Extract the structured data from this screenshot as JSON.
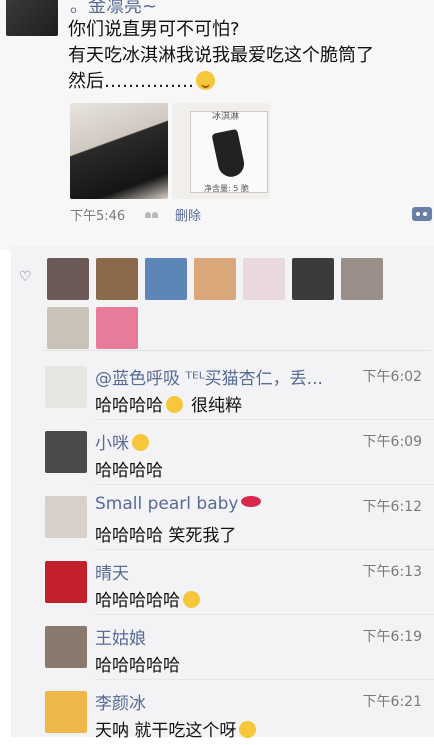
{
  "post": {
    "author": "。金凛亮~",
    "lines": [
      "你们说直男可不可怕?",
      "有天吃冰淇淋我说我最爱吃这个脆筒了",
      "然后……………"
    ],
    "photo2_caption_top": "冰淇淋",
    "photo2_caption_bottom": "净含量: 5 脆",
    "time": "下午5:46",
    "delete_label": "删除"
  },
  "likes": {
    "icon": "heart-outline-icon",
    "avatars": [
      {
        "color": "#6b5a58"
      },
      {
        "color": "#8a6a4a"
      },
      {
        "color": "#5d86b8"
      },
      {
        "color": "#d9a77a"
      },
      {
        "color": "#e9d8e0"
      },
      {
        "color": "#3b3b3b"
      },
      {
        "color": "#9a8f88"
      },
      {
        "color": "#c9c2b8"
      },
      {
        "color": "#e77c9a"
      }
    ]
  },
  "comments": [
    {
      "name": "@蓝色呼吸 ᵀᴱᴸ买猫杏仁，丢...",
      "time": "下午6:02",
      "text": "哈哈哈哈",
      "suffix": "很纯粹",
      "emoji": "grin-emoji",
      "avatar": "#e8e6e3"
    },
    {
      "name": "小咪",
      "time": "下午6:09",
      "text": "哈哈哈哈",
      "suffix": "",
      "emoji": "smirk-emoji",
      "avatar": "#4a4a4a"
    },
    {
      "name": "Small pearl baby",
      "time": "下午6:12",
      "text": "哈哈哈哈 笑死我了",
      "suffix": "",
      "emoji": "lips-emoji",
      "avatar": "#d6d0c8"
    },
    {
      "name": "晴天",
      "time": "下午6:13",
      "text": "哈哈哈哈哈",
      "suffix": "",
      "emoji": "laugh-emoji",
      "avatar": "#c2202a"
    },
    {
      "name": "王姑娘",
      "time": "下午6:19",
      "text": "哈哈哈哈哈",
      "suffix": "",
      "emoji": "",
      "avatar": "#8a7a6e"
    },
    {
      "name": "李颜冰",
      "time": "下午6:21",
      "text": "天呐 就干吃这个呀",
      "suffix": "",
      "emoji": "think-emoji",
      "avatar": "#f0b84a"
    }
  ]
}
